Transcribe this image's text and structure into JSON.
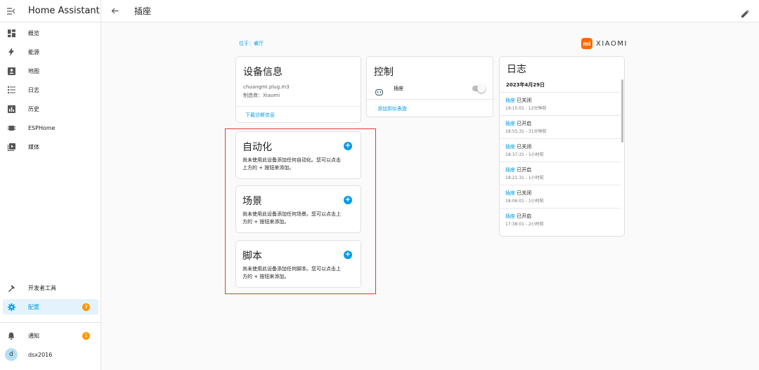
{
  "app": {
    "title": "Home Assistant"
  },
  "sidebar": {
    "items": [
      {
        "label": "概览",
        "icon": "dashboard-icon"
      },
      {
        "label": "能源",
        "icon": "lightning-icon"
      },
      {
        "label": "地图",
        "icon": "map-account-icon"
      },
      {
        "label": "日志",
        "icon": "list-icon"
      },
      {
        "label": "历史",
        "icon": "chart-box-icon"
      },
      {
        "label": "ESPHome",
        "icon": "chip-icon"
      },
      {
        "label": "媒体",
        "icon": "media-icon"
      }
    ],
    "developer_tools": "开发者工具",
    "config": {
      "label": "配置",
      "badge": "3"
    },
    "notifications": {
      "label": "通知",
      "badge": "1"
    },
    "user": {
      "name": "dsx2016",
      "initial": "d"
    }
  },
  "header": {
    "title": "插座"
  },
  "device": {
    "area_link": "位于：睿厅",
    "brand": {
      "mark": "mi",
      "text": "XIAOMI"
    }
  },
  "device_info": {
    "title": "设备信息",
    "model": "chuangmi.plug.m3",
    "manufacturer": "制造商：Xiaomi",
    "download_link": "下载诊断信息"
  },
  "control": {
    "title": "控制",
    "entity": "插座",
    "add_link": "添加到仪表盘"
  },
  "automation": {
    "title": "自动化",
    "desc_line1": "尚未使用此设备添加任何自动化。您可以点击",
    "desc_line2": "上方的 + 按钮来添加。"
  },
  "scene": {
    "title": "场景",
    "desc_line1": "尚未使用此设备添加任何场景。您可以点击上",
    "desc_line2": "方的 + 按钮来添加。"
  },
  "script": {
    "title": "脚本",
    "desc_line1": "尚未使用此设备添加任何脚本。您可以点击上",
    "desc_line2": "方的 + 按钮来添加。"
  },
  "logbook": {
    "title": "日志",
    "date": "2023年4月29日",
    "entries": [
      {
        "entity": "插座",
        "state": "已关闭",
        "time": "19:15:01 - 12分钟前"
      },
      {
        "entity": "插座",
        "state": "已开启",
        "time": "18:55:31 - 31分钟前"
      },
      {
        "entity": "插座",
        "state": "已关闭",
        "time": "18:37:31 - 1小时前"
      },
      {
        "entity": "插座",
        "state": "已开启",
        "time": "18:21:31 - 1小时前"
      },
      {
        "entity": "插座",
        "state": "已关闭",
        "time": "18:06:01 - 1小时前"
      },
      {
        "entity": "插座",
        "state": "已开启",
        "time": "17:38:01 - 2小时前"
      }
    ]
  }
}
